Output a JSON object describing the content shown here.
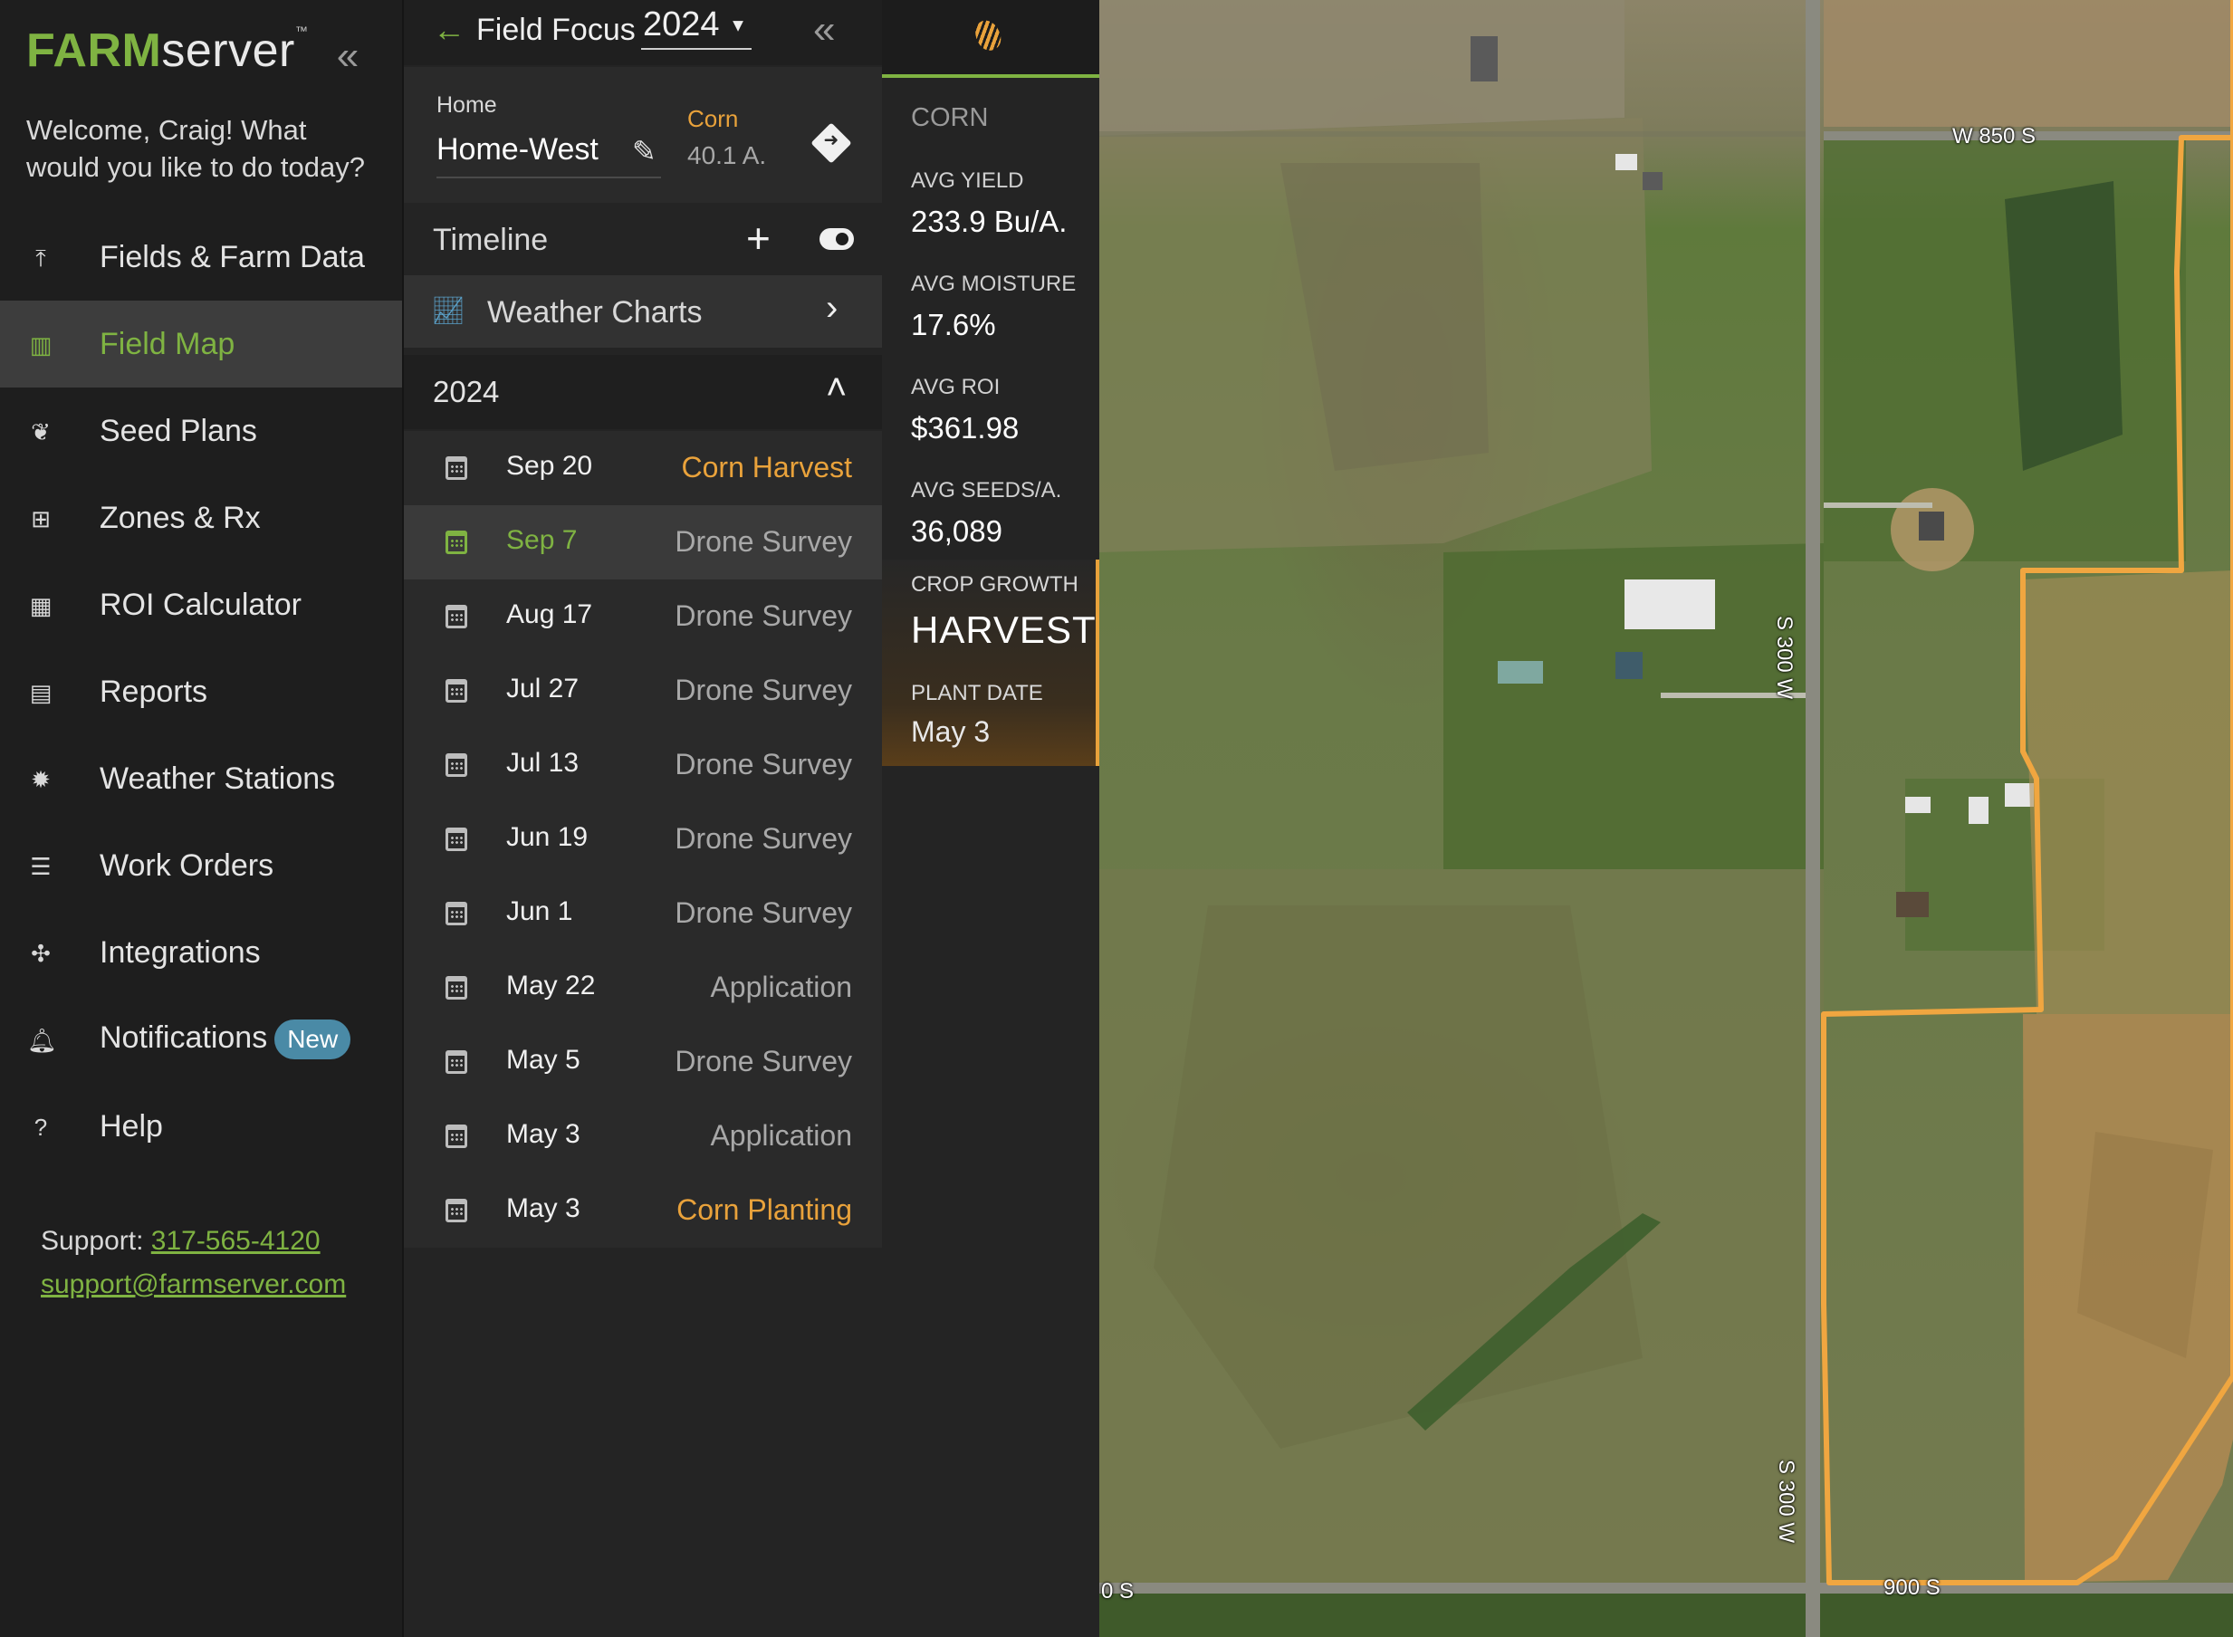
{
  "sidebar": {
    "logo_farm": "FARM",
    "logo_server": "server",
    "logo_tm": "™",
    "welcome": "Welcome, Craig! What would you like to do today?",
    "items": [
      {
        "label": "Fields & Farm Data",
        "icon": "upload-icon"
      },
      {
        "label": "Field Map",
        "icon": "map-icon",
        "active": true
      },
      {
        "label": "Seed Plans",
        "icon": "sprout-icon"
      },
      {
        "label": "Zones & Rx",
        "icon": "grid-icon"
      },
      {
        "label": "ROI Calculator",
        "icon": "calculator-icon"
      },
      {
        "label": "Reports",
        "icon": "report-icon"
      },
      {
        "label": "Weather Stations",
        "icon": "gear-icon"
      },
      {
        "label": "Work Orders",
        "icon": "checklist-icon"
      },
      {
        "label": "Integrations",
        "icon": "network-icon"
      },
      {
        "label": "Notifications",
        "icon": "bell-icon",
        "badge": "New"
      },
      {
        "label": "Help",
        "icon": "help-icon"
      }
    ],
    "support_label": "Support:",
    "support_phone": "317-565-4120",
    "support_email": "support@farmserver.com"
  },
  "panel": {
    "title": "Field Focus",
    "year": "2024",
    "home_label": "Home",
    "field_name": "Home-West",
    "crop": "Corn",
    "acres": "40.1 A.",
    "timeline_label": "Timeline",
    "weather_charts": "Weather Charts",
    "section_year": "2024",
    "events": [
      {
        "date": "Sep 20",
        "type": "Corn Harvest",
        "highlight": true
      },
      {
        "date": "Sep 7",
        "type": "Drone Survey",
        "active": true
      },
      {
        "date": "Aug 17",
        "type": "Drone Survey"
      },
      {
        "date": "Jul 27",
        "type": "Drone Survey"
      },
      {
        "date": "Jul 13",
        "type": "Drone Survey"
      },
      {
        "date": "Jun 19",
        "type": "Drone Survey"
      },
      {
        "date": "Jun 1",
        "type": "Drone Survey"
      },
      {
        "date": "May 22",
        "type": "Application"
      },
      {
        "date": "May 5",
        "type": "Drone Survey"
      },
      {
        "date": "May 3",
        "type": "Application"
      },
      {
        "date": "May 3",
        "type": "Corn Planting",
        "highlight": true
      }
    ]
  },
  "stats": {
    "crop": "CORN",
    "avg_yield_label": "AVG YIELD",
    "avg_yield": "233.9 Bu/A.",
    "avg_moisture_label": "AVG MOISTURE",
    "avg_moisture": "17.6%",
    "avg_roi_label": "AVG ROI",
    "avg_roi": "$361.98",
    "avg_seeds_label": "AVG SEEDS/A.",
    "avg_seeds": "36,089",
    "crop_growth_label": "CROP GROWTH",
    "crop_growth": "HARVEST",
    "plant_date_label": "PLANT DATE",
    "plant_date": "May 3"
  },
  "map": {
    "road_w850s": "W 850 S",
    "road_s300w_1": "S 300 W",
    "road_s300w_2": "S 300 W",
    "road_900s": "900 S",
    "road_partial": "0 S",
    "boundary_color": "#f0a640"
  },
  "colors": {
    "accent_green": "#7fb342",
    "accent_orange": "#e9a23b",
    "badge_blue": "#4a8aa6"
  }
}
